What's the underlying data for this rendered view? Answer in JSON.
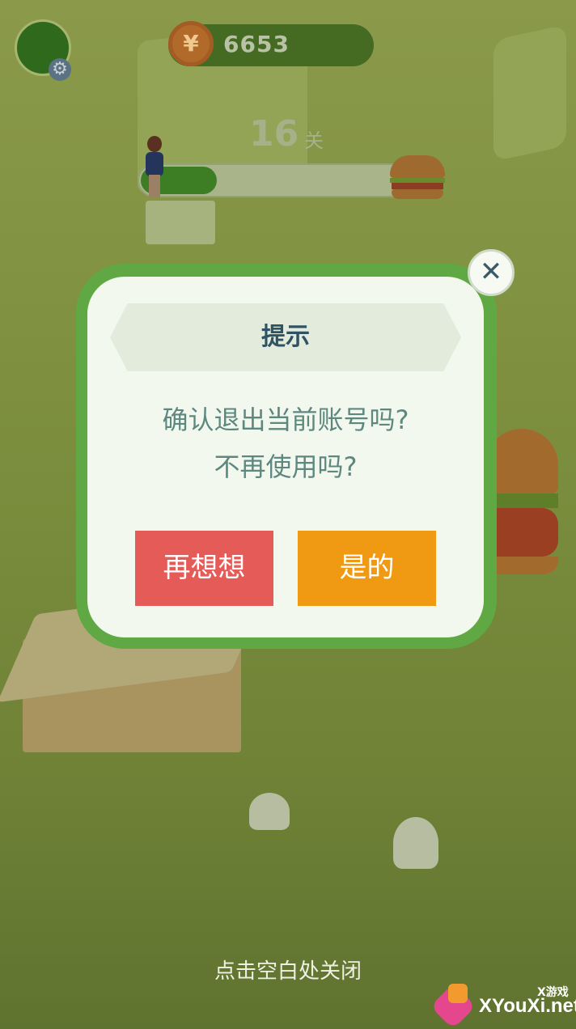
{
  "hud": {
    "coin_symbol": "¥",
    "coins": "6653",
    "level_number": "16",
    "level_unit": "关",
    "progress_fraction": 0.26
  },
  "dialog": {
    "title": "提示",
    "message_line1": "确认退出当前账号吗?",
    "message_line2": "不再使用吗?",
    "cancel_label": "再想想",
    "confirm_label": "是的",
    "close_glyph": "✕"
  },
  "overlay": {
    "hint": "点击空白处关闭"
  },
  "watermark": {
    "tag": "X游戏",
    "site": "XYouXi.net"
  },
  "colors": {
    "dialog_border": "#5fa844",
    "cancel_button": "#e55b58",
    "confirm_button": "#ef9a12",
    "title_text": "#2e5364",
    "message_text": "#5d8880"
  }
}
